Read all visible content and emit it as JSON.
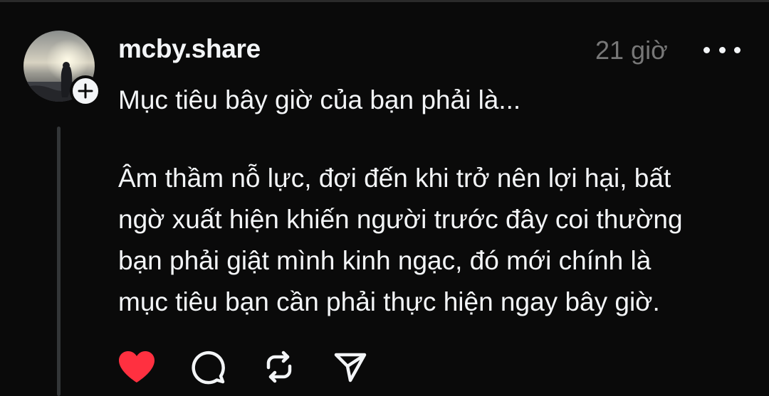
{
  "post": {
    "username": "mcby.share",
    "timestamp": "21 giờ",
    "title_line": "Mục tiêu bây giờ của bạn phải là...",
    "body_lines": [
      "Âm thầm nỗ lực, đợi đến khi trở nên lợi hại, bất",
      "ngờ xuất hiện khiến người trước đây coi thường",
      "bạn phải giật mình kinh ngạc, đó mới chính là",
      "mục tiêu bạn cần phải thực hiện ngay bây giờ."
    ]
  },
  "icons": {
    "avatar": "avatar",
    "follow": "plus-icon",
    "more": "more-horizontal-icon",
    "like": "heart-filled-icon",
    "comment": "comment-bubble-icon",
    "repost": "repost-icon",
    "share": "send-icon"
  },
  "colors": {
    "background": "#0a0a0a",
    "text": "#f3f5f7",
    "muted": "#777777",
    "like": "#ff3040",
    "thread_line": "#333638"
  },
  "state": {
    "liked": true
  }
}
